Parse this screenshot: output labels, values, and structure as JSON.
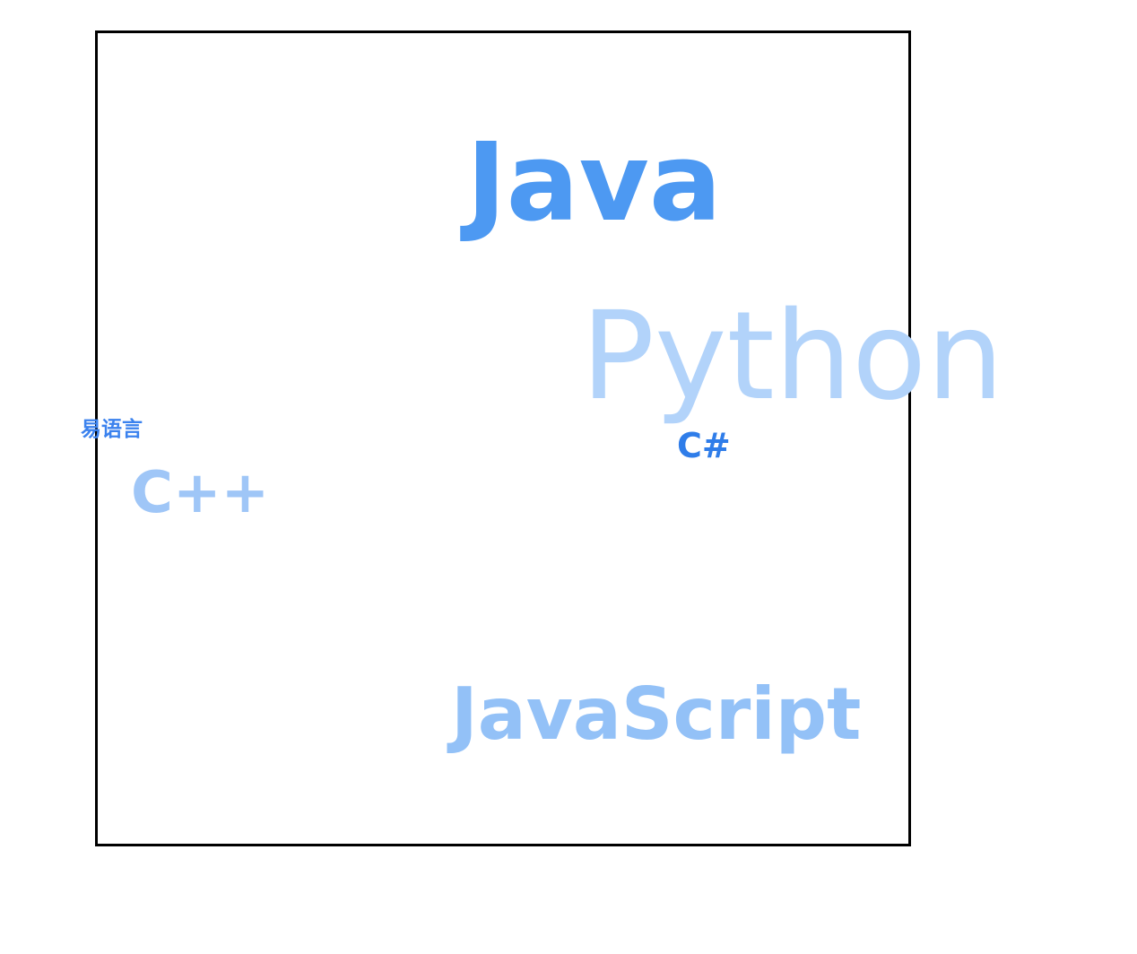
{
  "word_cloud": {
    "words": {
      "java": {
        "text": "Java",
        "color": "#4d99f2"
      },
      "python": {
        "text": "Python",
        "color": "#b2d3fa"
      },
      "javascript": {
        "text": "JavaScript",
        "color": "#93c1f7"
      },
      "cpp": {
        "text": "C++",
        "color": "#9fc6f7"
      },
      "csharp": {
        "text": "C#",
        "color": "#2f7de9"
      },
      "yiyuyan": {
        "text": "易语言",
        "color": "#3b82ee"
      }
    }
  }
}
